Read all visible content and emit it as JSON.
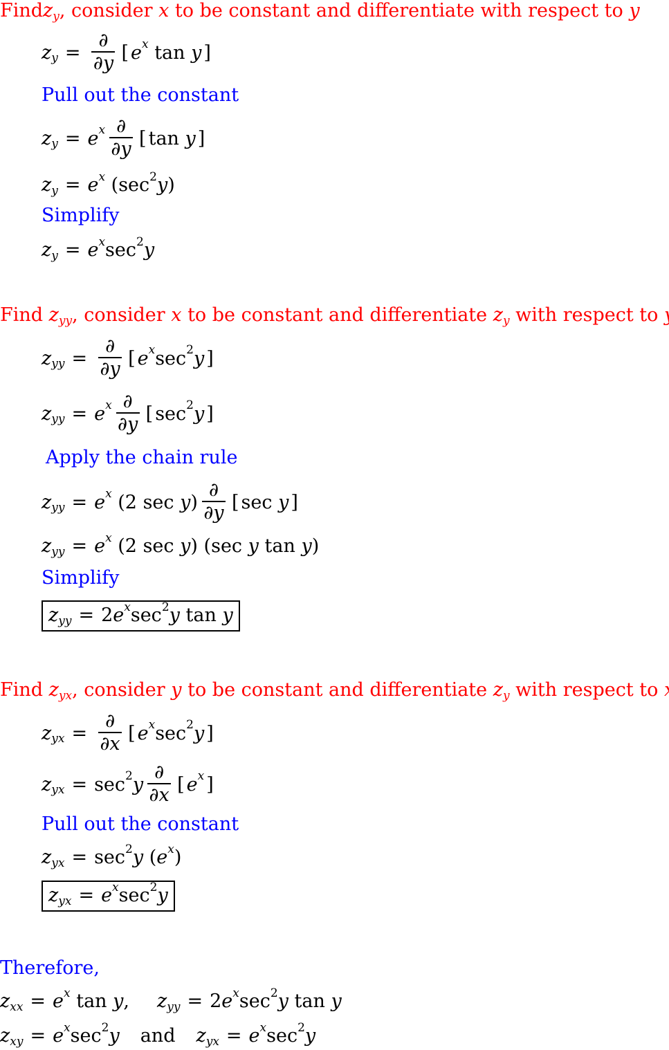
{
  "colors": {
    "heading": "#ff0000",
    "note": "#0000ff",
    "math": "#000000"
  },
  "section1": {
    "heading": {
      "find": "Find ",
      "var": "z",
      "sub": "y",
      "rest1": ", consider ",
      "cvar": "x",
      "rest2": " to be constant and differentiate with respect to ",
      "wrt": "y"
    },
    "steps": [
      {
        "lhs": "z",
        "lhs_sub": "y",
        "text": "∂/∂y [eˣ tan y]"
      },
      {
        "note": "Pull out the constant"
      },
      {
        "lhs": "z",
        "lhs_sub": "y",
        "text": "eˣ ∂/∂y [tan y]"
      },
      {
        "lhs": "z",
        "lhs_sub": "y",
        "text": "eˣ (sec²y)"
      },
      {
        "note": "Simplify"
      },
      {
        "lhs": "z",
        "lhs_sub": "y",
        "text": "eˣ sec²y"
      }
    ]
  },
  "section2": {
    "heading": {
      "find": "Find ",
      "var": "z",
      "sub": "yy",
      "rest1": ", consider ",
      "cvar": "x",
      "rest2": " to be constant and differentiate ",
      "dvar": "z",
      "dsub": "y",
      "rest3": " with respect to ",
      "wrt": "y"
    },
    "steps": [
      {
        "lhs": "z",
        "lhs_sub": "yy",
        "text": "∂/∂y [eˣ sec²y]"
      },
      {
        "lhs": "z",
        "lhs_sub": "yy",
        "text": "eˣ ∂/∂y [sec²y]"
      },
      {
        "note": "Apply the chain rule"
      },
      {
        "lhs": "z",
        "lhs_sub": "yy",
        "text": "eˣ (2 sec y) ∂/∂y [sec y]"
      },
      {
        "lhs": "z",
        "lhs_sub": "yy",
        "text": "eˣ (2 sec y)(sec y tan y)"
      },
      {
        "note": "Simplify"
      },
      {
        "lhs": "z",
        "lhs_sub": "yy",
        "text": "2eˣ sec²y tan y",
        "boxed": true
      }
    ]
  },
  "section3": {
    "heading": {
      "find": "Find ",
      "var": "z",
      "sub": "yx",
      "rest1": ", consider ",
      "cvar": "y",
      "rest2": " to be constant and differentiate ",
      "dvar": "z",
      "dsub": "y",
      "rest3": " with respect to ",
      "wrt": "x"
    },
    "steps": [
      {
        "lhs": "z",
        "lhs_sub": "yx",
        "text": "∂/∂x [eˣ sec²y]"
      },
      {
        "lhs": "z",
        "lhs_sub": "yx",
        "text": "sec²y ∂/∂x [eˣ]"
      },
      {
        "note": "Pull out the constant"
      },
      {
        "lhs": "z",
        "lhs_sub": "yx",
        "text": "sec²y (eˣ)"
      },
      {
        "lhs": "z",
        "lhs_sub": "yx",
        "text": "eˣ sec²y",
        "boxed": true
      }
    ]
  },
  "summary": {
    "label": "Therefore,",
    "line1": "z_xx = eˣ tan y,   z_yy = 2eˣ sec²y tan y",
    "line2": "z_xy = eˣ sec²y   and   z_yx = eˣ sec²y",
    "and": "and"
  },
  "sym": {
    "z": "z",
    "e": "e",
    "x": "x",
    "y": "y",
    "eq": "=",
    "d": "∂",
    "tan": "tan",
    "sec": "sec",
    "two": "2",
    "comma": ",",
    "lb": "[",
    "rb": "]",
    "lp": "(",
    "rp": ")",
    "s_y": "y",
    "s_yy": "yy",
    "s_yx": "yx",
    "s_xx": "xx",
    "s_xy": "xy"
  }
}
